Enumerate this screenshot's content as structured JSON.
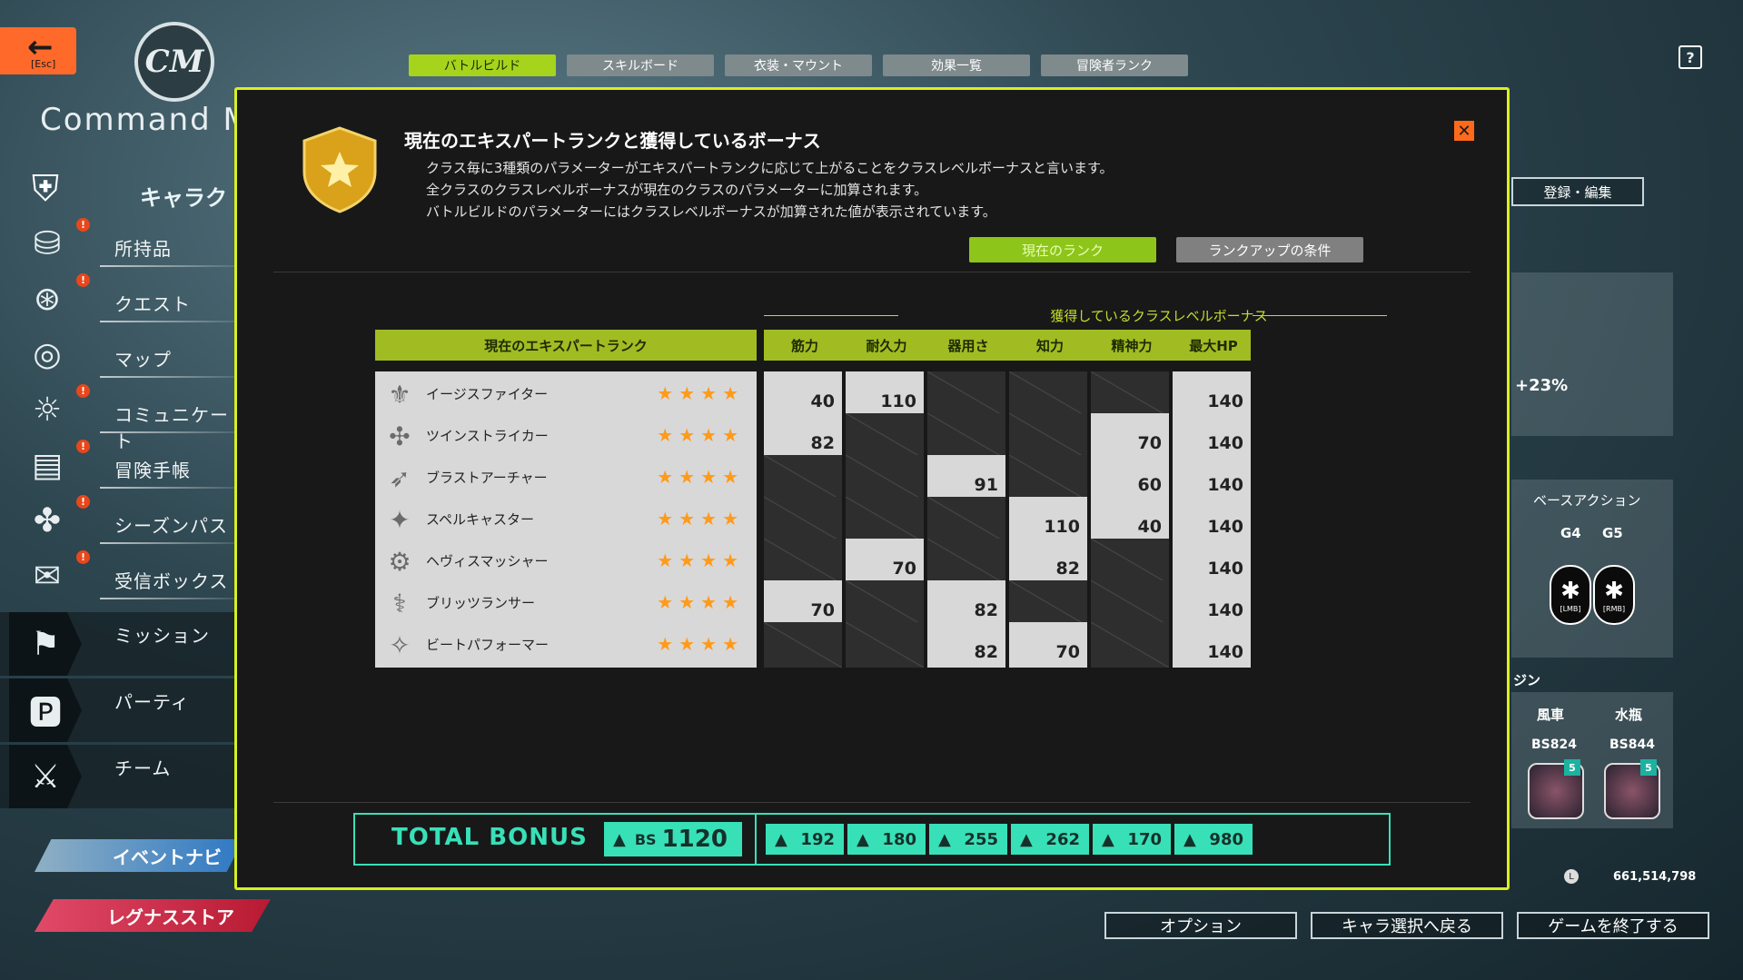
{
  "top": {
    "esc_label": "[Esc]",
    "logo_text": "CM",
    "app_title": "Command M",
    "help": "?",
    "tabs": [
      "バトルビルド",
      "スキルボード",
      "衣装・マウント",
      "効果一覧",
      "冒険者ランク"
    ],
    "active_tab": 0
  },
  "sidebar": {
    "header_label": "キャラク",
    "items": [
      {
        "label": "所持品",
        "badge": "!",
        "icon": "bag-icon"
      },
      {
        "label": "クエスト",
        "badge": "!",
        "icon": "quest-icon"
      },
      {
        "label": "マップ",
        "badge": "",
        "icon": "map-icon"
      },
      {
        "label": "コミュニケート",
        "badge": "!",
        "icon": "handshake-icon"
      },
      {
        "label": "冒険手帳",
        "badge": "!",
        "icon": "book-icon"
      },
      {
        "label": "シーズンパス",
        "badge": "!",
        "icon": "seasonpass-icon"
      },
      {
        "label": "受信ボックス",
        "badge": "!",
        "icon": "mail-icon"
      }
    ],
    "dark_items": [
      {
        "label": "ミッション",
        "icon": "flag-icon"
      },
      {
        "label": "パーティ",
        "icon": "party-icon"
      },
      {
        "label": "チーム",
        "icon": "team-icon"
      }
    ],
    "event_navi": "イベントナビ",
    "store": "レグナスストア"
  },
  "right_panel": {
    "register_edit": "登録・編集",
    "percent": "+23%",
    "base_action_title": "ベースアクション",
    "g4": "G4",
    "g5": "G5",
    "lmb": "[LMB]",
    "rmb": "[RMB]",
    "sign_label_partial": "ジン",
    "signs": [
      {
        "name": "風車",
        "code": "BS824",
        "badge": "5"
      },
      {
        "name": "水瓶",
        "code": "BS844",
        "badge": "5"
      }
    ],
    "money": "661,514,798"
  },
  "bottom_buttons": [
    "オプション",
    "キャラ選択へ戻る",
    "ゲームを終了する"
  ],
  "modal": {
    "title": "現在のエキスパートランクと獲得しているボーナス",
    "desc": [
      "クラス毎に3種類のパラメーターがエキスパートランクに応じて上がることをクラスレベルボーナスと言います。",
      "全クラスのクラスレベルボーナスが現在のクラスのパラメーターに加算されます。",
      "バトルビルドのパラメーターにはクラスレベルボーナスが加算された値が表示されています。"
    ],
    "btn_current": "現在のランク",
    "btn_condition": "ランクアップの条件",
    "bonus_title": "獲得しているクラスレベルボーナス",
    "rank_header": "現在のエキスパートランク",
    "stat_headers": [
      "筋力",
      "耐久力",
      "器用さ",
      "知力",
      "精神力",
      "最大HP"
    ],
    "rows": [
      {
        "name": "イージスファイター",
        "stars": "★★★★",
        "icon": "aegis-icon",
        "vals": [
          "40",
          "110",
          "",
          "",
          "",
          "140"
        ]
      },
      {
        "name": "ツインストライカー",
        "stars": "★★★★",
        "icon": "twin-icon",
        "vals": [
          "82",
          "",
          "",
          "",
          "70",
          "140"
        ]
      },
      {
        "name": "ブラストアーチャー",
        "stars": "★★★★",
        "icon": "archer-icon",
        "vals": [
          "",
          "",
          "91",
          "",
          "60",
          "140"
        ]
      },
      {
        "name": "スペルキャスター",
        "stars": "★★★★",
        "icon": "caster-icon",
        "vals": [
          "",
          "",
          "",
          "110",
          "40",
          "140"
        ]
      },
      {
        "name": "ヘヴィスマッシャー",
        "stars": "★★★★",
        "icon": "smasher-icon",
        "vals": [
          "",
          "70",
          "",
          "82",
          "",
          "140"
        ]
      },
      {
        "name": "ブリッツランサー",
        "stars": "★★★★",
        "icon": "lancer-icon",
        "vals": [
          "70",
          "",
          "82",
          "",
          "",
          "140"
        ]
      },
      {
        "name": "ビートパフォーマー",
        "stars": "★★★★",
        "icon": "performer-icon",
        "vals": [
          "",
          "",
          "82",
          "70",
          "",
          "140"
        ]
      }
    ],
    "total": {
      "label": "TOTAL BONUS",
      "bs_prefix": "BS",
      "bs_value": "1120",
      "values": [
        "192",
        "180",
        "255",
        "262",
        "170",
        "980"
      ]
    }
  },
  "colors": {
    "accent_green": "#a6d41c",
    "modal_border": "#d8ef22",
    "total_teal": "#38e0b8",
    "star_orange": "#ff9a1a",
    "esc_orange": "#ff6a2a"
  }
}
